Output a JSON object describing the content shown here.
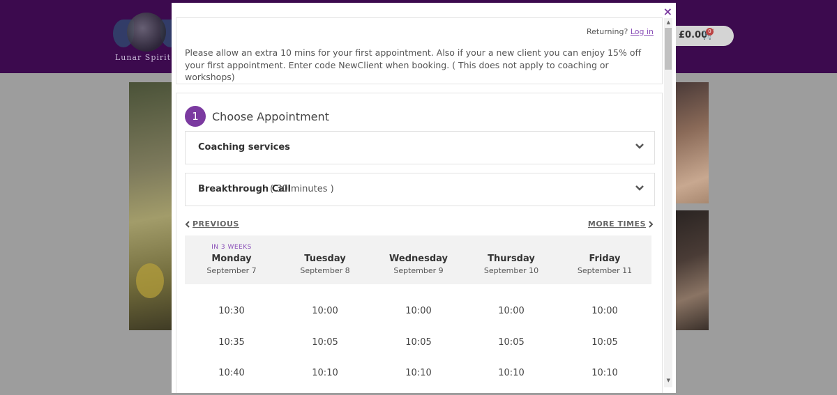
{
  "site": {
    "logo_text": "Lunar Spirit W",
    "cart_price": "£0.00",
    "cart_count": "0"
  },
  "modal": {
    "close_glyph": "×",
    "returning_text": "Returning?",
    "login_link": "Log in",
    "intro": "Please allow an extra 10 mins for your first appointment. Also if your a new client you can enjoy 15% off your first appointment. Enter code NewClient when booking. ( This does not apply to coaching or workshops)",
    "step_number": "1",
    "step_title": "Choose Appointment",
    "category": {
      "label": "Coaching services"
    },
    "service": {
      "label": "Breakthrough Call",
      "duration": "( 30 minutes )"
    },
    "prev_label": "PREVIOUS",
    "more_label": "MORE TIMES",
    "days": [
      {
        "tag": "IN 3 WEEKS",
        "name": "Monday",
        "date": "September 7",
        "times": [
          "10:30",
          "10:35",
          "10:40"
        ]
      },
      {
        "tag": "",
        "name": "Tuesday",
        "date": "September 8",
        "times": [
          "10:00",
          "10:05",
          "10:10"
        ]
      },
      {
        "tag": "",
        "name": "Wednesday",
        "date": "September 9",
        "times": [
          "10:00",
          "10:05",
          "10:10"
        ]
      },
      {
        "tag": "",
        "name": "Thursday",
        "date": "September 10",
        "times": [
          "10:00",
          "10:05",
          "10:10"
        ]
      },
      {
        "tag": "",
        "name": "Friday",
        "date": "September 11",
        "times": [
          "10:00",
          "10:05",
          "10:10"
        ]
      }
    ]
  },
  "colors": {
    "header_bg": "#3c0a4e",
    "accent": "#7b3aa0",
    "overlay_bg": "#9d9d9d"
  }
}
